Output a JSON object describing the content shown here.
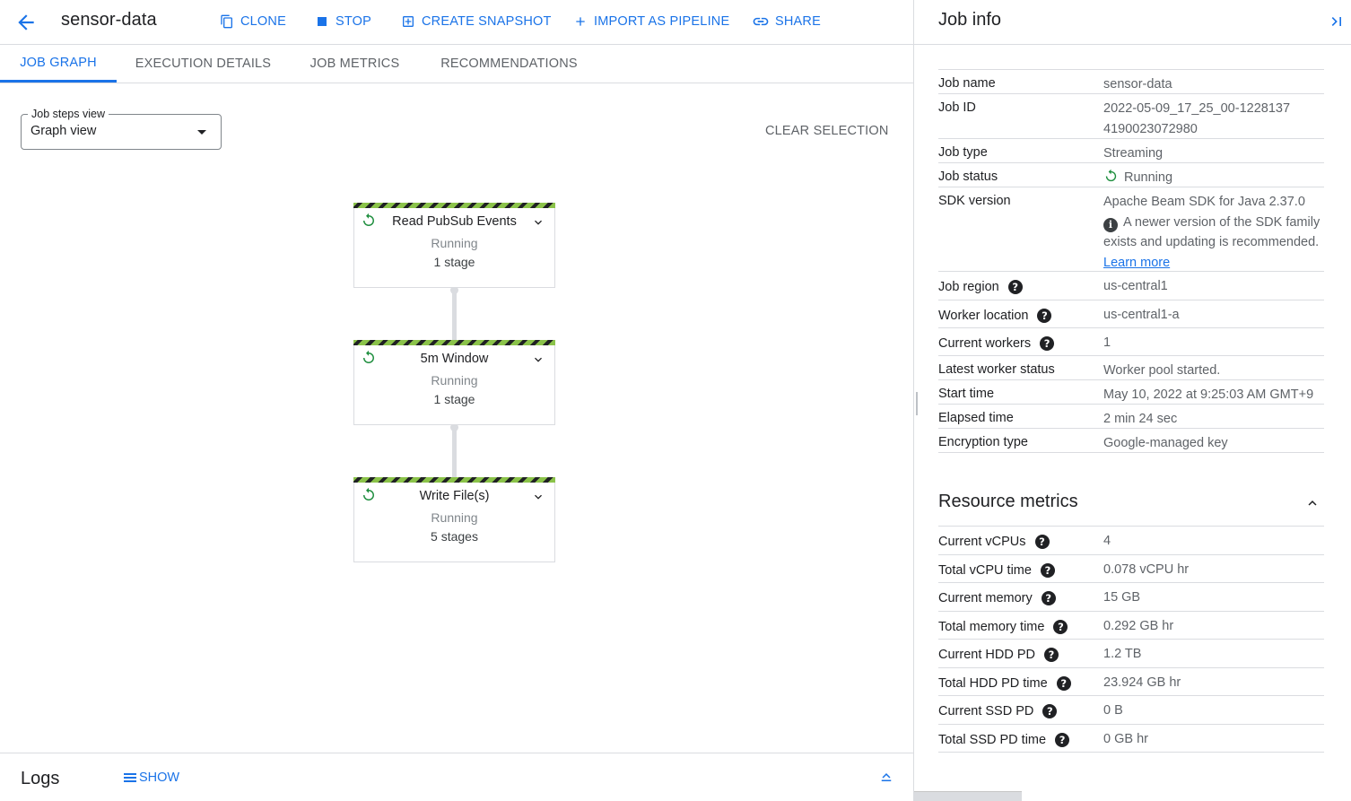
{
  "header": {
    "title": "sensor-data",
    "actions": [
      {
        "label": "CLONE",
        "icon": "copy-icon"
      },
      {
        "label": "STOP",
        "icon": "stop-icon"
      },
      {
        "label": "CREATE SNAPSHOT",
        "icon": "snapshot-icon"
      },
      {
        "label": "IMPORT AS PIPELINE",
        "icon": "plus-icon"
      },
      {
        "label": "SHARE",
        "icon": "link-icon"
      }
    ]
  },
  "tabs": [
    {
      "label": "JOB GRAPH",
      "active": true
    },
    {
      "label": "EXECUTION DETAILS",
      "active": false
    },
    {
      "label": "JOB METRICS",
      "active": false
    },
    {
      "label": "RECOMMENDATIONS",
      "active": false
    }
  ],
  "graph": {
    "steps_select_label": "Job steps view",
    "steps_select_value": "Graph view",
    "clear_selection": "CLEAR SELECTION",
    "nodes": [
      {
        "title": "Read PubSub Events",
        "status": "Running",
        "stages": "1 stage"
      },
      {
        "title": "5m Window",
        "status": "Running",
        "stages": "1 stage"
      },
      {
        "title": "Write File(s)",
        "status": "Running",
        "stages": "5 stages"
      }
    ]
  },
  "logs": {
    "title": "Logs",
    "show": "SHOW"
  },
  "job_info": {
    "title": "Job info",
    "rows": [
      {
        "key": "Job name",
        "value": "sensor-data"
      },
      {
        "key": "Job ID",
        "value": "2022-05-09_17_25_00-12281374190023072980"
      },
      {
        "key": "Job type",
        "value": "Streaming"
      },
      {
        "key": "Job status",
        "value": "Running"
      },
      {
        "key": "SDK version",
        "value": "Apache Beam SDK for Java 2.37.0",
        "note": "A newer version of the SDK family exists and updating is recommended.",
        "link": "Learn more"
      },
      {
        "key": "Job region",
        "value": "us-central1"
      },
      {
        "key": "Worker location",
        "value": "us-central1-a"
      },
      {
        "key": "Current workers",
        "value": "1"
      },
      {
        "key": "Latest worker status",
        "value": "Worker pool started."
      },
      {
        "key": "Start time",
        "value": "May 10, 2022 at 9:25:03 AM GMT+9"
      },
      {
        "key": "Elapsed time",
        "value": "2 min 24 sec"
      },
      {
        "key": "Encryption type",
        "value": "Google-managed key"
      }
    ]
  },
  "resource_metrics": {
    "title": "Resource metrics",
    "rows": [
      {
        "key": "Current vCPUs",
        "value": "4"
      },
      {
        "key": "Total vCPU time",
        "value": "0.078 vCPU hr"
      },
      {
        "key": "Current memory",
        "value": "15 GB"
      },
      {
        "key": "Total memory time",
        "value": "0.292 GB hr"
      },
      {
        "key": "Current HDD PD",
        "value": "1.2 TB"
      },
      {
        "key": "Total HDD PD time",
        "value": "23.924 GB hr"
      },
      {
        "key": "Current SSD PD",
        "value": "0 B"
      },
      {
        "key": "Total SSD PD time",
        "value": "0 GB hr"
      }
    ]
  },
  "colors": {
    "accent": "#1a73e8",
    "running": "#1e8e3e",
    "stripe": "#8bc34a"
  }
}
